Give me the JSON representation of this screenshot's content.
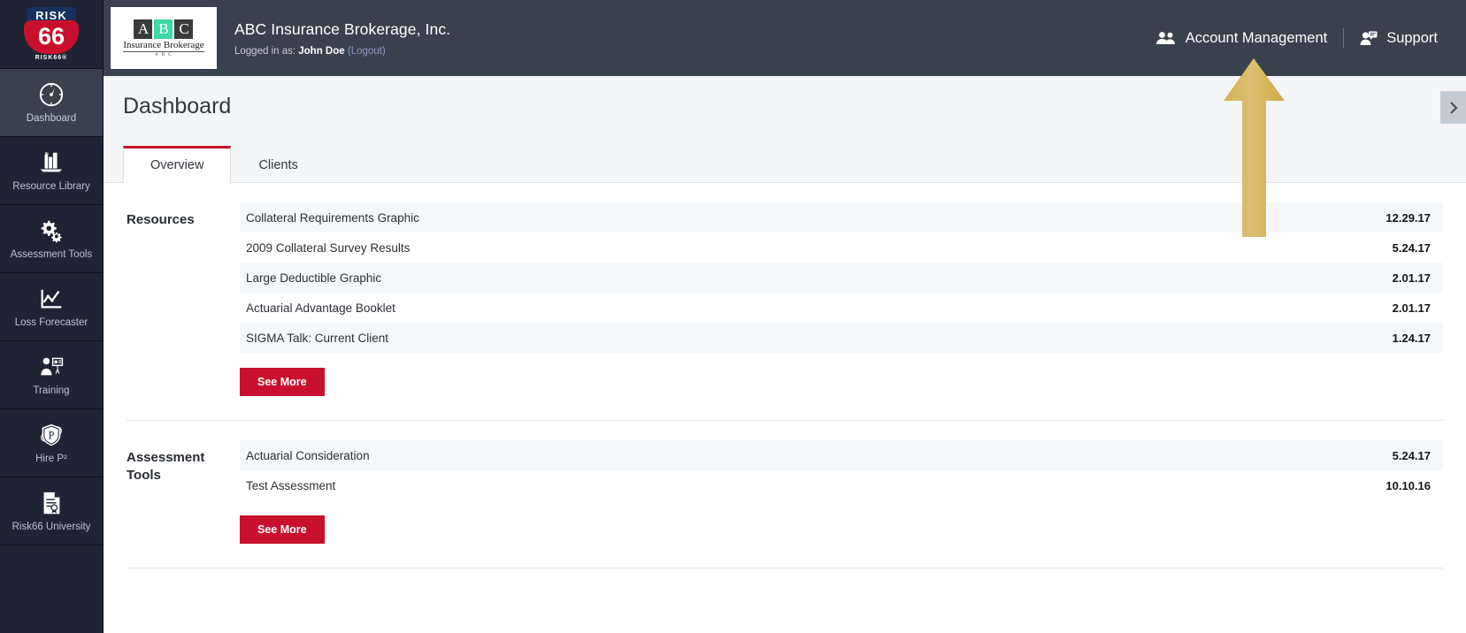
{
  "brand": {
    "top_text": "RISK",
    "number": "66",
    "sub_text": "RISK66®"
  },
  "sidebar": {
    "items": [
      {
        "label": "Dashboard",
        "icon": "speedometer-icon",
        "active": true
      },
      {
        "label": "Resource Library",
        "icon": "books-icon",
        "active": false
      },
      {
        "label": "Assessment Tools",
        "icon": "gears-icon",
        "active": false
      },
      {
        "label": "Loss Forecaster",
        "icon": "line-chart-icon",
        "active": false
      },
      {
        "label": "Training",
        "icon": "presenter-icon",
        "active": false
      },
      {
        "label": "Hire P²",
        "icon": "shield-p-icon",
        "active": false
      },
      {
        "label": "Risk66 University",
        "icon": "certificate-icon",
        "active": false
      }
    ]
  },
  "topbar": {
    "client_logo": {
      "letters": [
        "A",
        "B",
        "C"
      ],
      "name": "Insurance Brokerage",
      "tag": "A B C"
    },
    "company_name": "ABC Insurance Brokerage, Inc.",
    "logged_in_prefix": "Logged in as:",
    "logged_in_user": "John Doe",
    "logout_label": "(Logout)",
    "account_management_label": "Account Management",
    "account_management_icon": "users-icon",
    "support_label": "Support",
    "support_icon": "support-agent-icon"
  },
  "page": {
    "title": "Dashboard",
    "tabs": [
      {
        "label": "Overview",
        "active": true
      },
      {
        "label": "Clients",
        "active": false
      }
    ],
    "panel_toggle_icon": "chevron-right-icon"
  },
  "sections": [
    {
      "label": "Resources",
      "see_more_label": "See More",
      "rows": [
        {
          "name": "Collateral Requirements Graphic",
          "date": "12.29.17"
        },
        {
          "name": "2009 Collateral Survey Results",
          "date": "5.24.17"
        },
        {
          "name": "Large Deductible Graphic",
          "date": "2.01.17"
        },
        {
          "name": "Actuarial Advantage Booklet",
          "date": "2.01.17"
        },
        {
          "name": "SIGMA Talk: Current Client",
          "date": "1.24.17"
        }
      ]
    },
    {
      "label": "Assessment Tools",
      "see_more_label": "See More",
      "rows": [
        {
          "name": "Actuarial Consideration",
          "date": "5.24.17"
        },
        {
          "name": "Test Assessment",
          "date": "10.10.16"
        }
      ]
    }
  ],
  "annotation": {
    "arrow_icon": "up-arrow-annotation",
    "color": "#d9b75a"
  },
  "colors": {
    "sidebar_bg": "#1e2433",
    "topbar_bg": "#39414f",
    "accent_crimson": "#c8102e",
    "row_alt": "#f4f8fb",
    "page_head_bg": "#f3f5f7"
  }
}
